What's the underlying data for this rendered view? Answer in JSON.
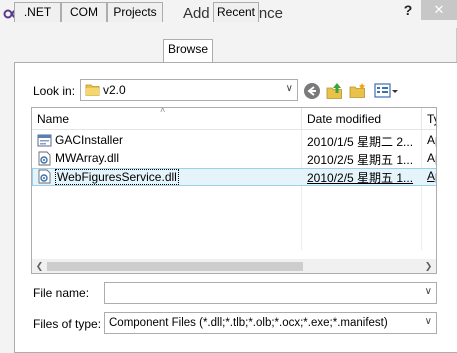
{
  "window": {
    "title": "Add Reference",
    "help_label": "?",
    "close_label": "✕"
  },
  "tabs": [
    {
      "label": ".NET"
    },
    {
      "label": "COM"
    },
    {
      "label": "Projects"
    },
    {
      "label": "Browse",
      "active": true
    },
    {
      "label": "Recent"
    }
  ],
  "look_in": {
    "label": "Look in:",
    "value": "v2.0"
  },
  "toolbar_icons": [
    "back-icon",
    "up-folder-icon",
    "new-folder-icon",
    "view-menu-icon"
  ],
  "columns": [
    "Name",
    "Date modified",
    "Ty"
  ],
  "files": [
    {
      "name": "GACInstaller",
      "date": "2010/1/5 星期二 2...",
      "type": "Ap",
      "icon": "executable-icon"
    },
    {
      "name": "MWArray.dll",
      "date": "2010/2/5 星期五 1...",
      "type": "Ap",
      "icon": "dll-icon"
    },
    {
      "name": "WebFiguresService.dll",
      "date": "2010/2/5 星期五 1...",
      "type": "Ap",
      "icon": "dll-icon",
      "selected": true
    }
  ],
  "file_name": {
    "label": "File name:",
    "value": ""
  },
  "files_of_type": {
    "label": "Files of type:",
    "value": "Component Files (*.dll;*.tlb;*.olb;*.ocx;*.exe;*.manifest)"
  },
  "colors": {
    "selection_bg": "#e5f3fb",
    "selection_border": "#9ed0ee",
    "close_button": "#c7c7c7"
  }
}
